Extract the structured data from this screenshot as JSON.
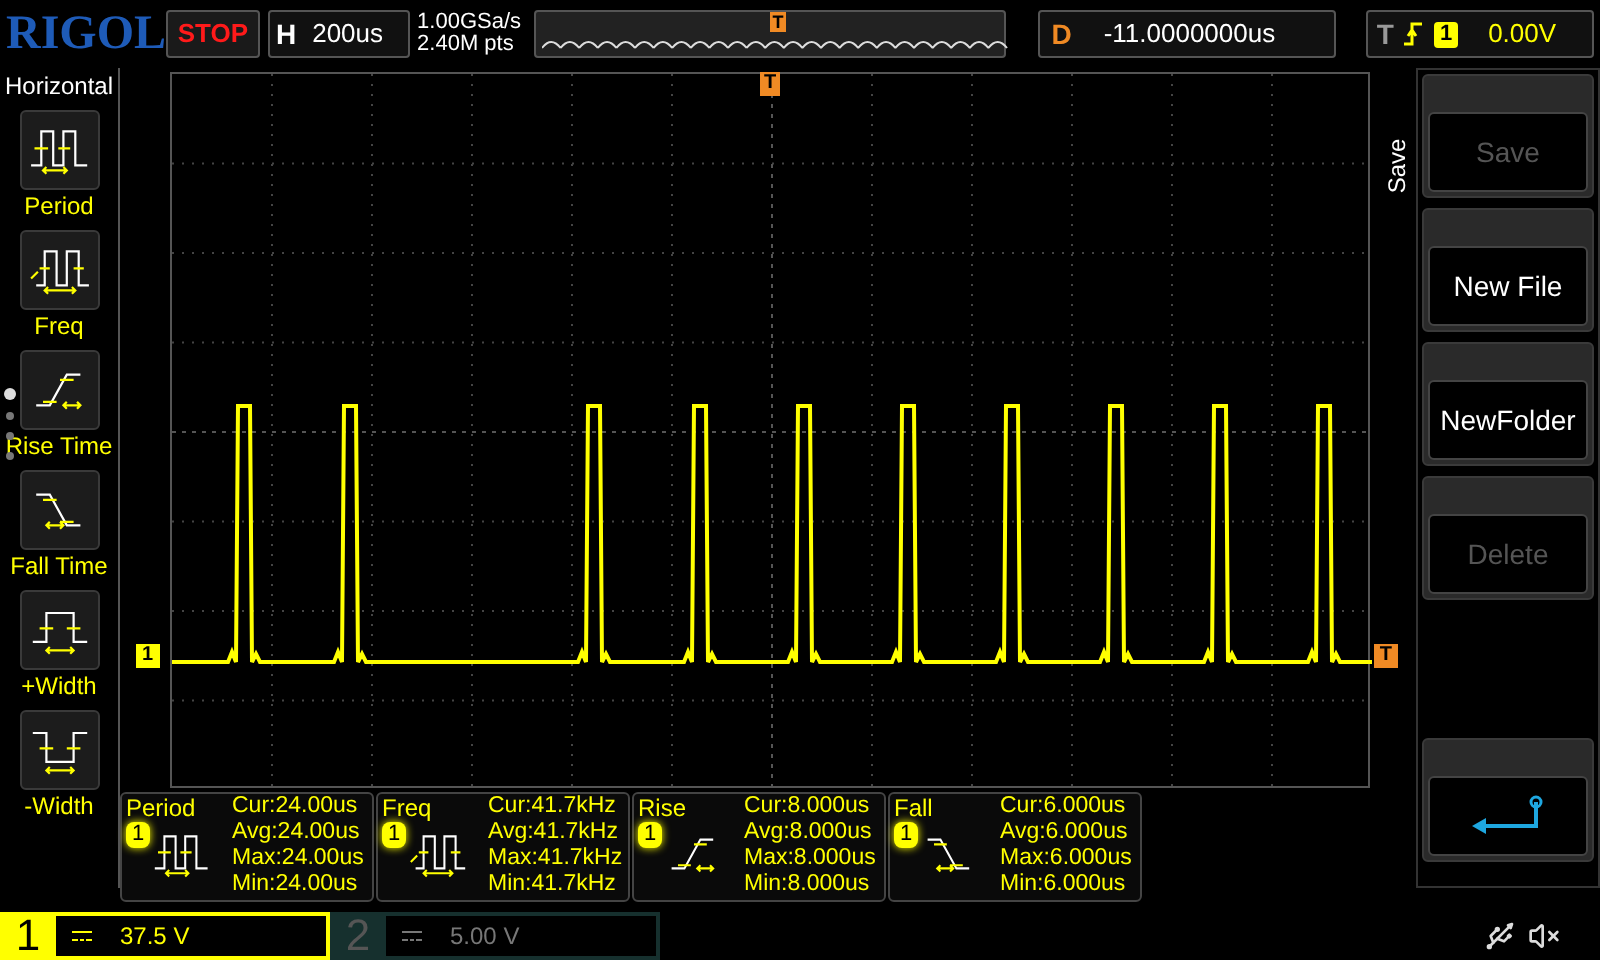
{
  "top_bar": {
    "logo": "RIGOL",
    "run_state": "STOP",
    "horizontal": {
      "label": "H",
      "timebase": "200us"
    },
    "sample_rate": "1.00GSa/s",
    "memory_depth": "2.40M pts",
    "overview_trigger_marker": "T",
    "delay": {
      "label": "D",
      "value": "-11.0000000us"
    },
    "trigger": {
      "label": "T",
      "source": "1",
      "level": "0.00V"
    }
  },
  "left_panel": {
    "title": "Horizontal",
    "pages": [
      {
        "selected": true
      },
      {
        "selected": false
      },
      {
        "selected": false
      },
      {
        "selected": false
      }
    ],
    "items": [
      {
        "label": "Period",
        "kind": "period"
      },
      {
        "label": "Freq",
        "kind": "freq"
      },
      {
        "label": "Rise Time",
        "kind": "rise"
      },
      {
        "label": "Fall Time",
        "kind": "fall"
      },
      {
        "label": "+Width",
        "kind": "pos_width"
      },
      {
        "label": "-Width",
        "kind": "neg_width"
      }
    ]
  },
  "display": {
    "trigger_position_marker": "T",
    "channel_marker": "1",
    "trigger_level_marker": "T"
  },
  "right_menu": {
    "title": "Save",
    "buttons": [
      {
        "label": "Save",
        "disabled": true
      },
      {
        "label": "New File",
        "disabled": false
      },
      {
        "label": "NewFolder",
        "disabled": false
      },
      {
        "label": "Delete",
        "disabled": true
      }
    ]
  },
  "measurements": [
    {
      "name": "Period",
      "channel": "1",
      "kind": "period",
      "lines": [
        "Cur:24.00us",
        "Avg:24.00us",
        "Max:24.00us",
        "Min:24.00us"
      ]
    },
    {
      "name": "Freq",
      "channel": "1",
      "kind": "freq",
      "lines": [
        "Cur:41.7kHz",
        "Avg:41.7kHz",
        "Max:41.7kHz",
        "Min:41.7kHz"
      ]
    },
    {
      "name": "Rise",
      "channel": "1",
      "kind": "rise",
      "lines": [
        "Cur:8.000us",
        "Avg:8.000us",
        "Max:8.000us",
        "Min:8.000us"
      ]
    },
    {
      "name": "Fall",
      "channel": "1",
      "kind": "fall",
      "lines": [
        "Cur:6.000us",
        "Avg:6.000us",
        "Max:6.000us",
        "Min:6.000us"
      ]
    }
  ],
  "channels": [
    {
      "number": "1",
      "scale": "37.5 V",
      "active": true
    },
    {
      "number": "2",
      "scale": "5.00 V",
      "active": false
    }
  ]
}
